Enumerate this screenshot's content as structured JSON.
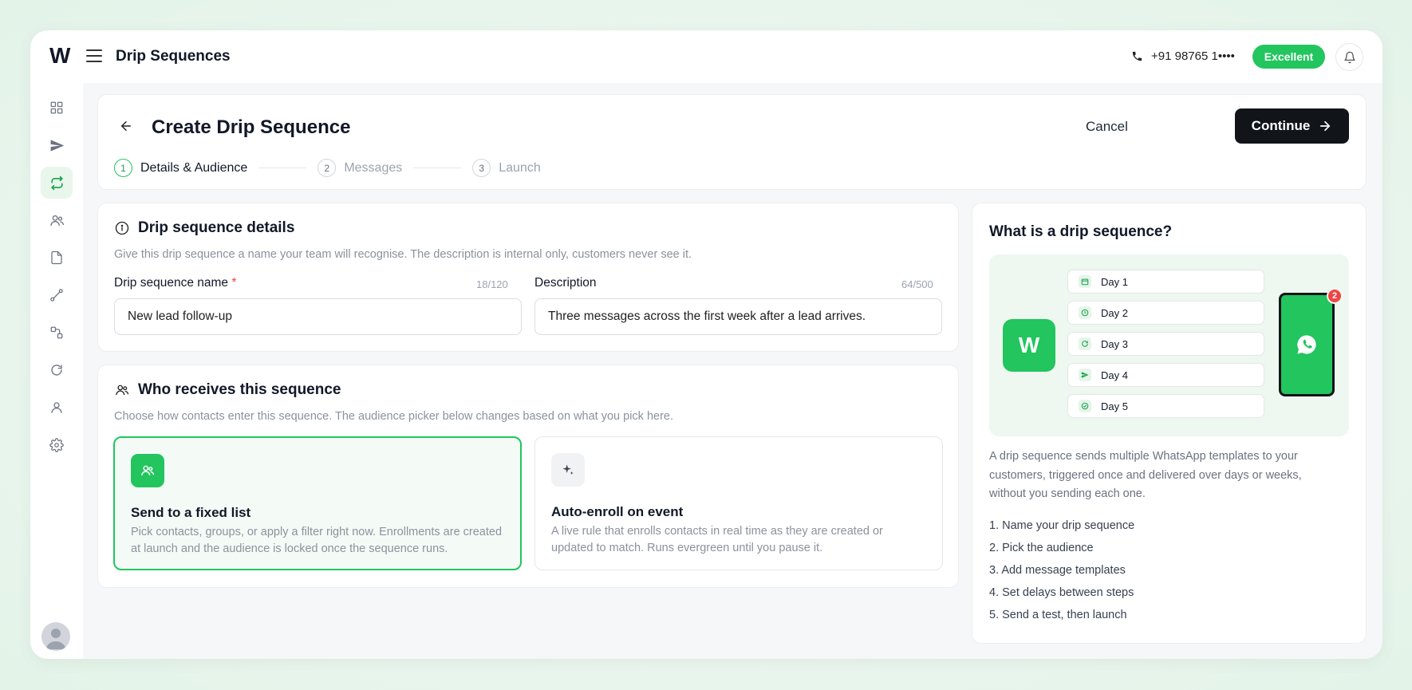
{
  "app": {
    "logo": "W",
    "title": "Drip Sequences",
    "phone": "+91 98765 1••••",
    "quality_badge": "Excellent"
  },
  "sidebar": {
    "items": [
      {
        "name": "dashboard-icon",
        "active": false
      },
      {
        "name": "send-icon",
        "active": false
      },
      {
        "name": "drip-cycle-icon",
        "active": true
      },
      {
        "name": "contacts-icon",
        "active": false
      },
      {
        "name": "document-icon",
        "active": false
      },
      {
        "name": "flow-icon",
        "active": false
      },
      {
        "name": "integrations-icon",
        "active": false
      },
      {
        "name": "refresh-icon",
        "active": false
      },
      {
        "name": "user-icon",
        "active": false
      },
      {
        "name": "settings-icon",
        "active": false
      }
    ]
  },
  "header": {
    "title": "Create Drip Sequence",
    "cancel_label": "Cancel",
    "continue_label": "Continue",
    "steps": [
      {
        "num": "1",
        "label": "Details & Audience",
        "active": true
      },
      {
        "num": "2",
        "label": "Messages",
        "active": false
      },
      {
        "num": "3",
        "label": "Launch",
        "active": false
      }
    ]
  },
  "details": {
    "title": "Drip sequence details",
    "subtitle": "Give this drip sequence a name your team will recognise. The description is internal only, customers never see it.",
    "name_label": "Drip sequence name",
    "name_required": "*",
    "name_counter": "18/120",
    "name_value": "New lead follow-up",
    "desc_label": "Description",
    "desc_counter": "64/500",
    "desc_value": "Three messages across the first week after a lead arrives."
  },
  "audience": {
    "title": "Who receives this sequence",
    "subtitle": "Choose how contacts enter this sequence. The audience picker below changes based on what you pick here.",
    "options": [
      {
        "title": "Send to a fixed list",
        "description": "Pick contacts, groups, or apply a filter right now. Enrollments are created at launch and the audience is locked once the sequence runs.",
        "selected": true
      },
      {
        "title": "Auto-enroll on event",
        "description": "A live rule that enrolls contacts in real time as they are created or updated to match. Runs evergreen until you pause it.",
        "selected": false
      }
    ]
  },
  "info": {
    "title": "What is a drip sequence?",
    "illustration": {
      "tile_letter": "W",
      "days": [
        "Day 1",
        "Day 2",
        "Day 3",
        "Day 4",
        "Day 5"
      ],
      "notification_count": "2"
    },
    "description": "A drip sequence sends multiple WhatsApp templates to your customers, triggered once and delivered over days or weeks, without you sending each one.",
    "steps": [
      "1. Name your drip sequence",
      "2. Pick the audience",
      "3. Add message templates",
      "4. Set delays between steps",
      "5. Send a test, then launch"
    ]
  },
  "colors": {
    "accent": "#22c55e",
    "dark_button": "#111418",
    "danger": "#ef4444"
  }
}
